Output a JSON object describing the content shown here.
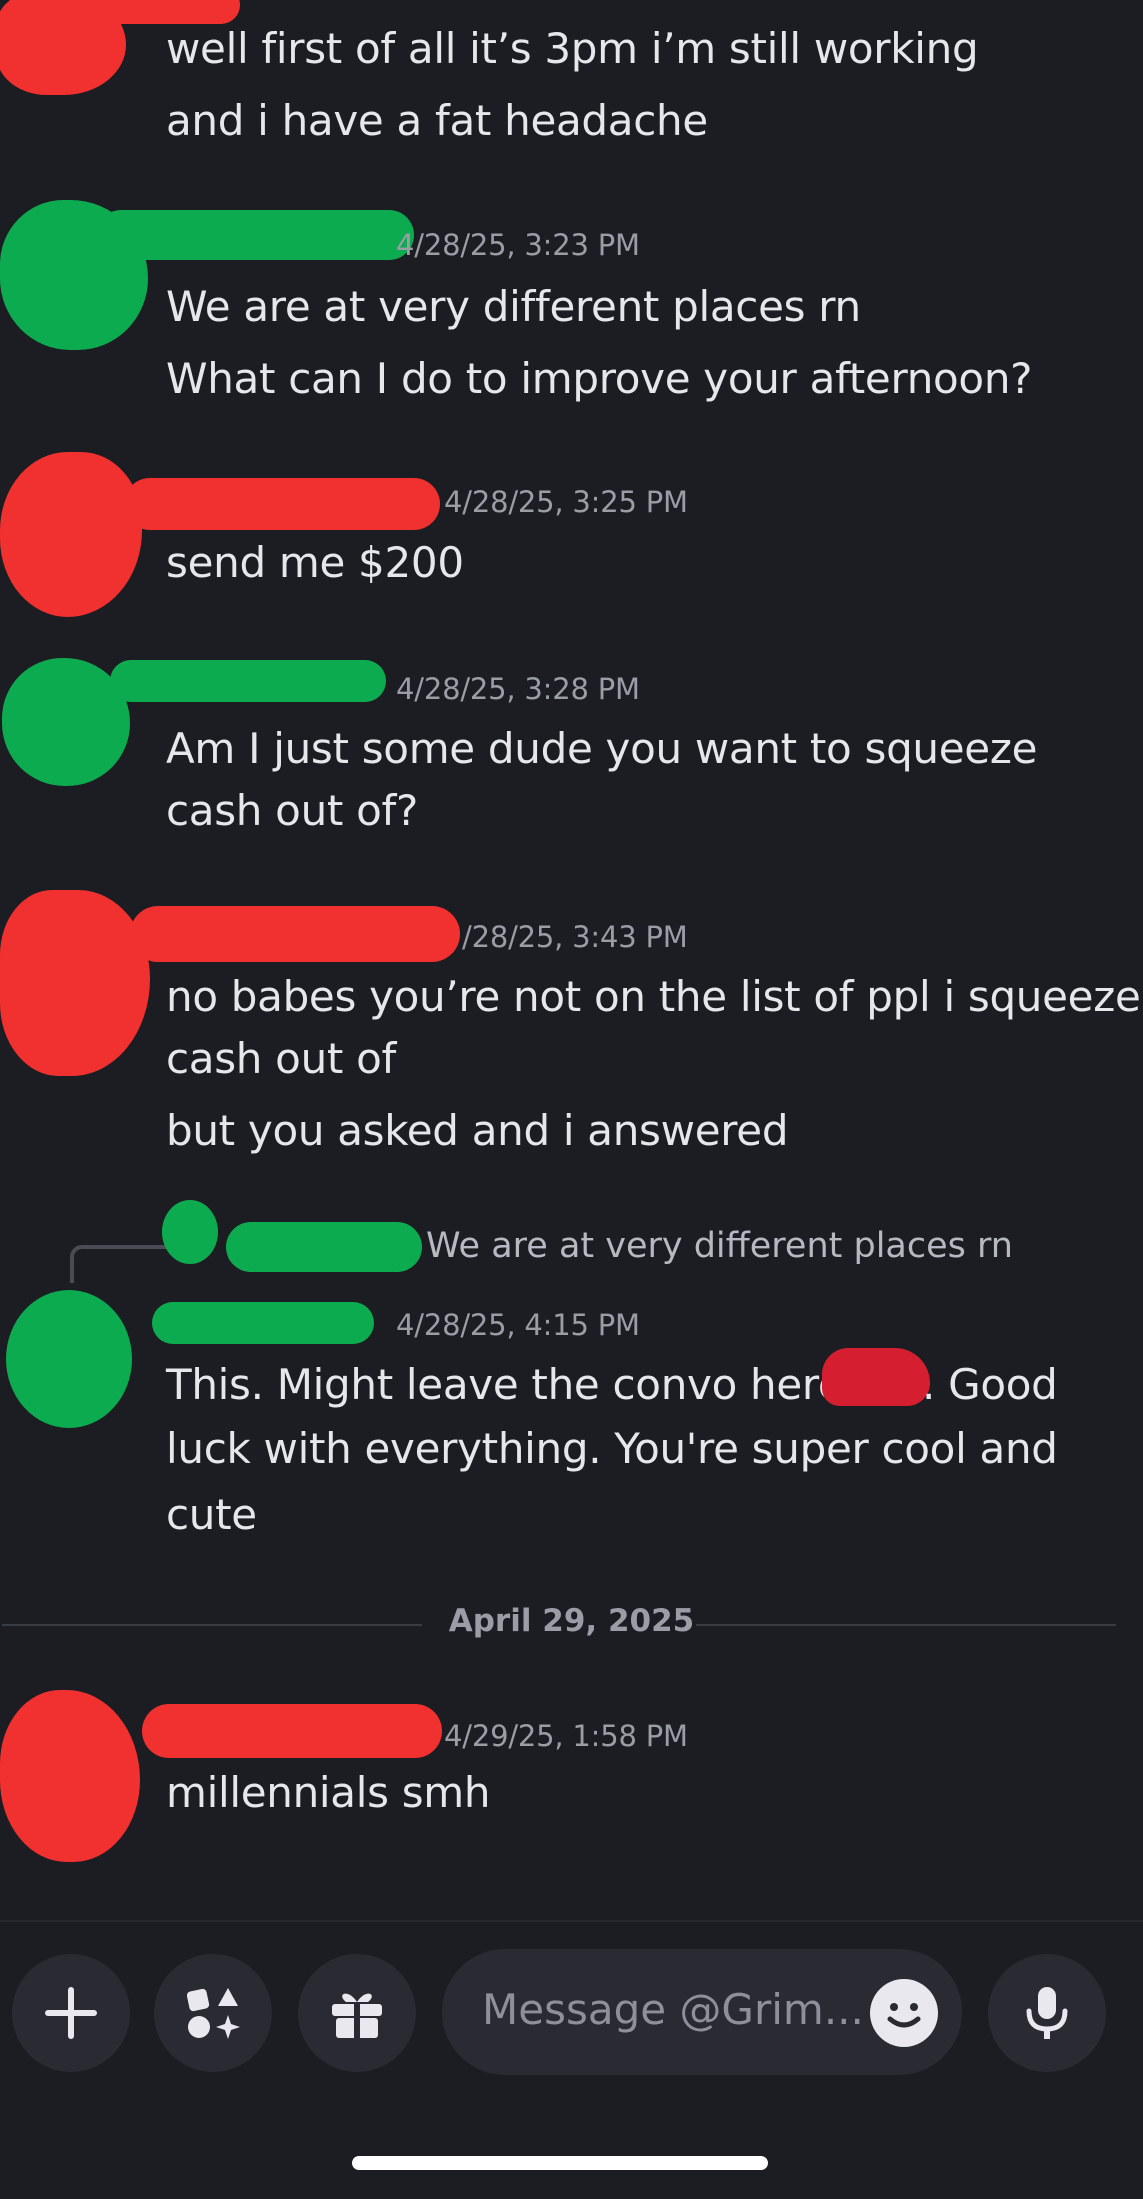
{
  "messages": [
    {
      "id": "m1",
      "timestamp": "",
      "lines": [
        "well first of all it’s 3pm i’m still working",
        "and i have a fat headache"
      ]
    },
    {
      "id": "m2",
      "timestamp": "4/28/25, 3:23 PM",
      "lines": [
        "We are at very different places rn",
        "What can I do to improve your afternoon?"
      ]
    },
    {
      "id": "m3",
      "timestamp": "4/28/25, 3:25 PM",
      "lines": [
        "send me $200"
      ]
    },
    {
      "id": "m4",
      "timestamp": "4/28/25, 3:28 PM",
      "lines": [
        "Am I just some dude you want to squeeze",
        "cash out of?"
      ]
    },
    {
      "id": "m5",
      "timestamp": "/28/25, 3:43 PM",
      "lines": [
        "no babes you’re not on the list of ppl i squeeze",
        "cash out of",
        "but you asked and i answered"
      ]
    },
    {
      "id": "m6",
      "reply_preview": "We are at very different places rn",
      "timestamp": "4/28/25, 4:15 PM",
      "lines": [
        "This. Might leave the convo here",
        ". Good",
        "luck with everything. You're super cool and",
        "cute"
      ]
    },
    {
      "id": "m7",
      "timestamp": "4/29/25, 1:58 PM",
      "lines": [
        "millennials smh"
      ]
    }
  ],
  "date_divider": "April 29, 2025",
  "composer": {
    "placeholder": "Message @Grim...",
    "buttons": [
      "plus-icon",
      "apps-icon",
      "gift-icon",
      "emoji-icon",
      "mic-icon"
    ]
  },
  "colors": {
    "background": "#1c1d22",
    "redaction_red": "#f0312f",
    "redaction_green": "#0dab50"
  }
}
